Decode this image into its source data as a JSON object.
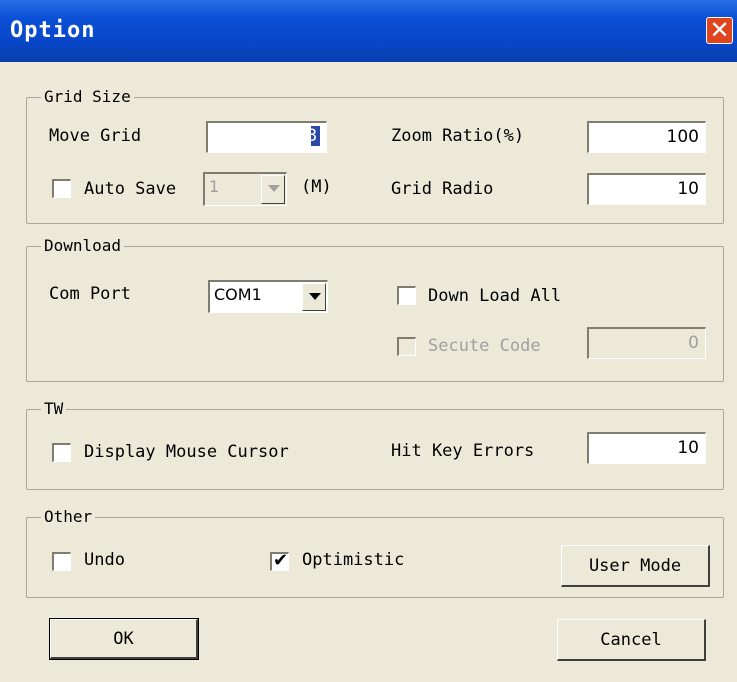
{
  "window": {
    "title": "Option",
    "close": "✕"
  },
  "grid_size": {
    "label": "Grid Size",
    "move_grid_label": "Move Grid",
    "move_grid_value": "3",
    "zoom_ratio_label": "Zoom Ratio(%)",
    "zoom_ratio_value": "100",
    "auto_save_label": "Auto Save",
    "auto_save_value": "1",
    "auto_save_unit": "(M)",
    "grid_radio_label": "Grid Radio",
    "grid_radio_value": "10"
  },
  "download": {
    "label": "Download",
    "com_port_label": "Com Port",
    "com_port_value": "COM1",
    "down_load_all_label": "Down Load All",
    "secute_code_label": "Secute Code",
    "secute_code_value": "0"
  },
  "tw": {
    "label": "TW",
    "display_mouse_cursor_label": "Display Mouse Cursor",
    "hit_key_errors_label": "Hit Key Errors",
    "hit_key_errors_value": "10"
  },
  "other": {
    "label": "Other",
    "undo_label": "Undo",
    "optimistic_label": "Optimistic",
    "optimistic_checked": "✔",
    "user_mode_label": "User Mode"
  },
  "buttons": {
    "ok": "OK",
    "cancel": "Cancel"
  },
  "colors": {
    "titlebar": "#0a4fd6",
    "close": "#e0451f",
    "face": "#ece9d8"
  }
}
